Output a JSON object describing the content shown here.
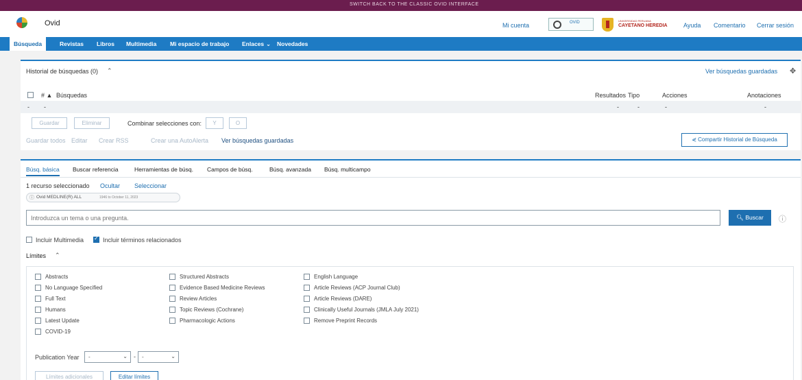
{
  "top_banner": {
    "text": "SWITCH BACK TO THE CLASSIC OVID INTERFACE"
  },
  "header": {
    "brand": "Ovid",
    "links": [
      "Mi cuenta",
      "Ayuda",
      "Comentario",
      "Cerrar sesión"
    ],
    "ovid_logo_text": "OVID",
    "university_name": "CAYETANO HEREDIA",
    "university_subtitle": "UNIVERSIDAD PERUANA"
  },
  "nav": {
    "items": [
      "Búsqueda",
      "Revistas",
      "Libros",
      "Multimedia",
      "Mi espacio de trabajo",
      "Enlaces",
      "Novedades"
    ],
    "active": "Búsqueda"
  },
  "history": {
    "title": "Historial de búsquedas (0)",
    "saved_link": "Ver búsquedas guardadas",
    "columns": [
      "# ▲",
      "Búsquedas",
      "Resultados",
      "Tipo",
      "Acciones",
      "Anotaciones"
    ],
    "empty_row": [
      "-",
      "-",
      "-",
      "-",
      "-",
      "-"
    ],
    "buttons": {
      "save": "Guardar",
      "delete": "Eliminar",
      "combine_label": "Combinar selecciones con:",
      "and": "Y",
      "or": "O"
    },
    "actions": [
      "Guardar todos",
      "Editar",
      "Crear RSS",
      "Crear una AutoAlerta",
      "Ver búsquedas guardadas"
    ],
    "share_button": "Compartir Historial de Búsqueda"
  },
  "search": {
    "tabs": [
      "Búsq. básica",
      "Buscar referencia",
      "Herramientas de búsq.",
      "Campos de búsq.",
      "Búsq. avanzada",
      "Búsq. multicampo"
    ],
    "active_tab": "Búsq. básica",
    "resources_label": "1 recurso seleccionado",
    "hide_link": "Ocultar",
    "select_link": "Seleccionar",
    "resource_chip": "Ovid MEDLINE(R) ALL",
    "resource_chip_range": "1946 to October 11, 2023",
    "placeholder": "Introduzca un tema o una pregunta.",
    "search_button": "Buscar",
    "include_multimedia": "Incluir Multimedia",
    "include_related": "Incluir términos relacionados",
    "include_related_checked": true
  },
  "limits": {
    "title": "Límites",
    "col1": [
      "Abstracts",
      "No Language Specified",
      "Full Text",
      "Humans",
      "Latest Update",
      "COVID-19"
    ],
    "col2": [
      "Structured Abstracts",
      "Evidence Based Medicine Reviews",
      "Review Articles",
      "Topic Reviews (Cochrane)",
      "Pharmacologic Actions"
    ],
    "col3": [
      "English Language",
      "Article Reviews (ACP Journal Club)",
      "Article Reviews (DARE)",
      "Clinically Useful Journals (JMLA July 2021)",
      "Remove Preprint Records"
    ],
    "publication_year_label": "Publication Year",
    "year_from": "-",
    "year_to": "-",
    "additional_button": "Límites adicionales",
    "edit_button": "Editar límites"
  }
}
